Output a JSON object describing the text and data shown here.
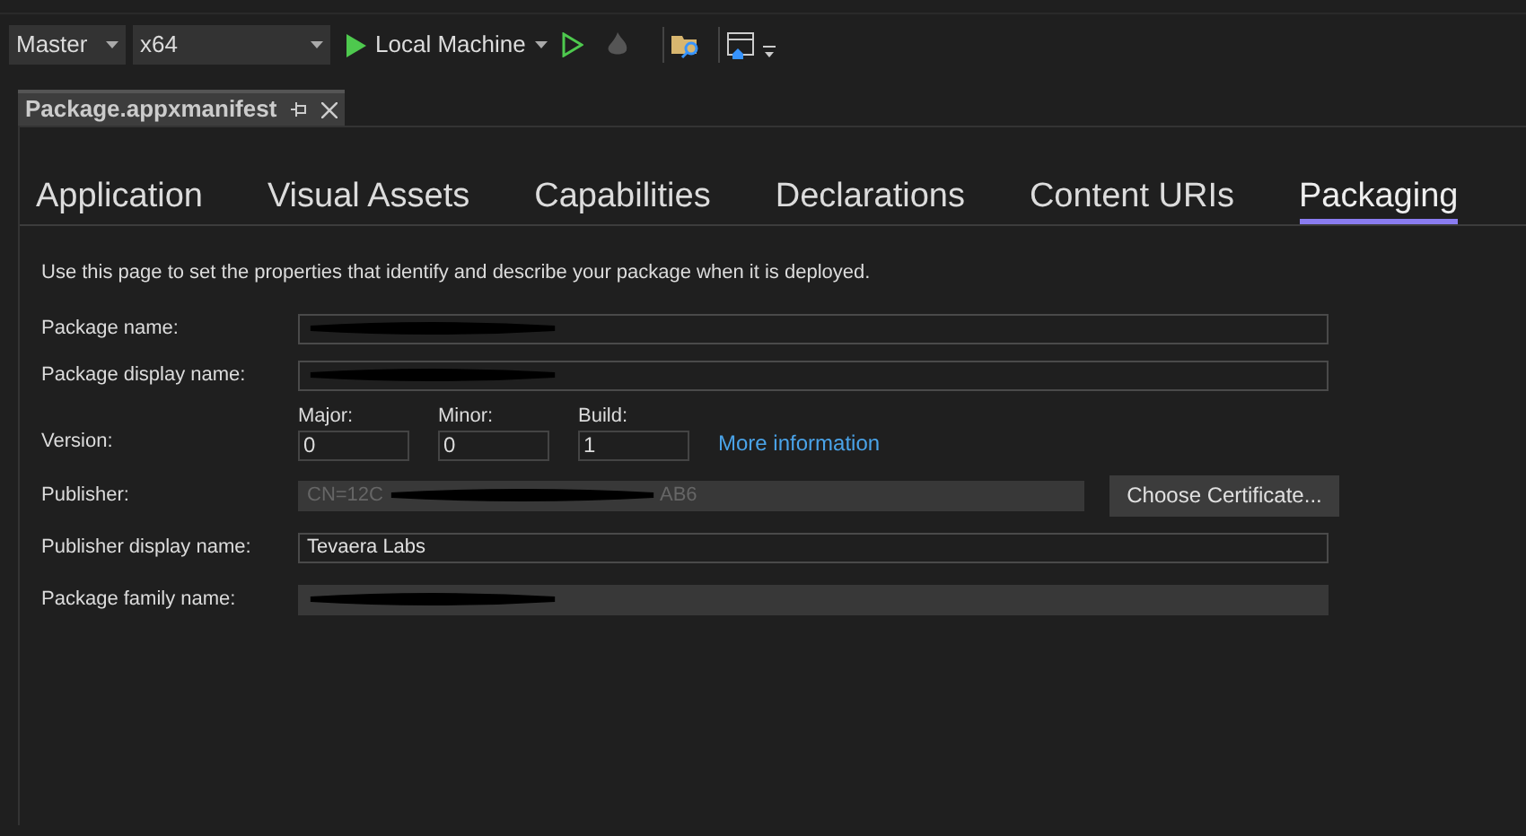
{
  "toolbar": {
    "configuration": "Master",
    "platform": "x64",
    "run_target": "Local Machine"
  },
  "document_tab": {
    "title": "Package.appxmanifest"
  },
  "tabs": [
    {
      "label": "Application",
      "selected": false
    },
    {
      "label": "Visual Assets",
      "selected": false
    },
    {
      "label": "Capabilities",
      "selected": false
    },
    {
      "label": "Declarations",
      "selected": false
    },
    {
      "label": "Content URIs",
      "selected": false
    },
    {
      "label": "Packaging",
      "selected": true
    }
  ],
  "description": "Use this page to set the properties that identify and describe your package when it is deployed.",
  "fields": [
    {
      "kind": "text",
      "label": "Package name:",
      "redacted": true,
      "disabled": false
    },
    {
      "kind": "text",
      "label": "Package display name:",
      "redacted": true,
      "disabled": false
    },
    {
      "kind": "version",
      "label": "Version:",
      "parts": [
        {
          "label": "Major:",
          "value": "0"
        },
        {
          "label": "Minor:",
          "value": "0"
        },
        {
          "label": "Build:",
          "value": "1"
        }
      ],
      "link": "More information"
    },
    {
      "kind": "text",
      "label": "Publisher:",
      "value": "CN=12C",
      "suffix": "AB6",
      "redacted": true,
      "disabled": true,
      "button": "Choose Certificate..."
    },
    {
      "kind": "text",
      "label": "Publisher display name:",
      "value": "Tevaera Labs",
      "redacted": false,
      "disabled": false
    },
    {
      "kind": "text",
      "label": "Package family name:",
      "redacted": true,
      "disabled": true
    }
  ]
}
